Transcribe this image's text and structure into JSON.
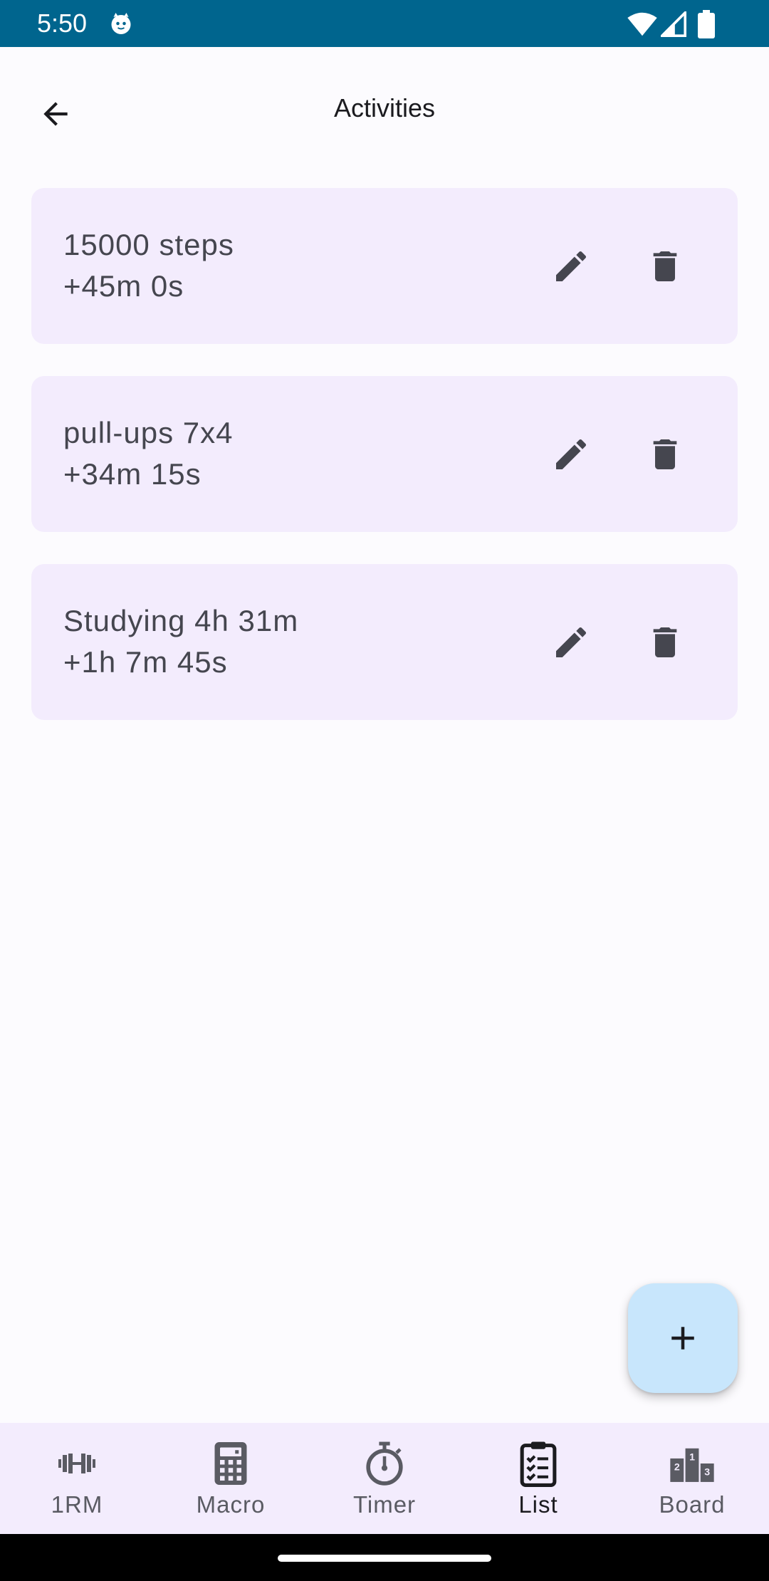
{
  "status_bar": {
    "time": "5:50",
    "background": "#00658e"
  },
  "header": {
    "title": "Activities",
    "back_icon": "arrow-back-icon"
  },
  "activities": [
    {
      "line1": "15000 steps",
      "line2": "+45m 0s"
    },
    {
      "line1": "pull-ups 7x4",
      "line2": "+34m 15s"
    },
    {
      "line1": "Studying 4h 31m",
      "line2": "+1h 7m 45s"
    }
  ],
  "card_actions": {
    "edit_icon": "pencil-icon",
    "delete_icon": "trash-icon"
  },
  "fab": {
    "icon": "plus-icon",
    "color": "#c8e6fc"
  },
  "bottom_nav": {
    "active": "List",
    "items": [
      {
        "label": "1RM",
        "icon": "dumbbell-icon"
      },
      {
        "label": "Macro",
        "icon": "calculator-icon"
      },
      {
        "label": "Timer",
        "icon": "stopwatch-icon"
      },
      {
        "label": "List",
        "icon": "checklist-icon"
      },
      {
        "label": "Board",
        "icon": "podium-icon"
      }
    ]
  },
  "colors": {
    "card_background": "#f3ecfd",
    "page_background": "#fcfbfe",
    "icon_dark": "#45464f"
  }
}
